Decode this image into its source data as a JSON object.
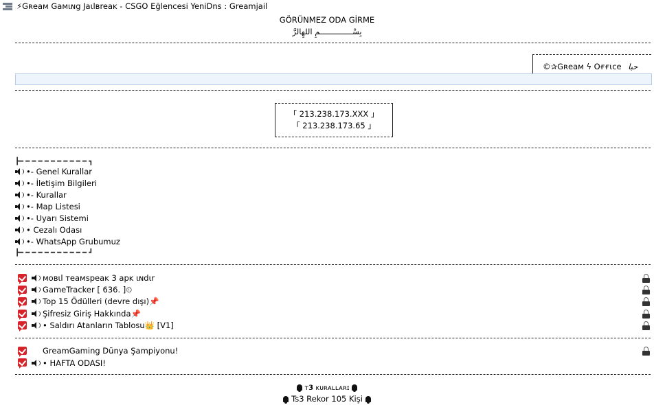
{
  "window": {
    "title": "⚡Gʀeaм Gaмιɴg Jaιlвreaĸ - CSGO Eğlencesi  YeniDns : Greamjail"
  },
  "header": {
    "line1": "GÖRÜNMEZ ODA GİRME",
    "line2": "بِسْــــــــــــــمِ اللهِالرَّ"
  },
  "office": {
    "label": "©✰Gʀeaм ϟ Oғғιce",
    "signature": "ﺣﺒﺎ"
  },
  "servers": [
    "「 213.238.173.XXX 」",
    "「 213.238.173.65 」"
  ],
  "menu": {
    "top_bracket": "┣━ ━ ━ ━ ━ ━ ━ ━ ━ ━ ━ ┓",
    "bottom_bracket": "┣━ ━ ━ ━ ━ ━ ━ ━ ━ ━ ━ ┛",
    "items": [
      "•- Genel Kurallar",
      "•- İletişim Bilgileri",
      "•- Kurallar",
      "•- Map Listesi",
      "•- Uyarı Sistemi",
      "•  Cezalı Odası",
      "•- WhatsApp Grubumuz"
    ]
  },
  "channels_a": [
    "мoвιl тeaмѕpeaĸ 3 apĸ ιɴdιr",
    "GameTracker [ 636. ]⏲",
    "Top 15 Ödülleri (devre dışı)📌",
    "Şifresiz Giriş Hakkında📌",
    "• Saldırı Atanların Tablosu👑 [V1]"
  ],
  "channels_b": [
    "GreamGaming Dünya Şampiyonu!",
    "• HAFTA ODASI!"
  ],
  "footer": {
    "line1": "ᴛ𝟯 ᴋᴜʀᴀʟʟᴀʀɪ",
    "line2": "Ts3 Rekor 105 Kişi"
  }
}
